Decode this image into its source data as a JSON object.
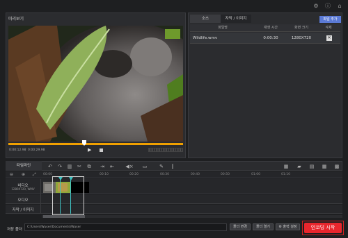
{
  "top_icons": [
    "gear-icon",
    "info-icon",
    "home-icon"
  ],
  "preview": {
    "title": "미리보기",
    "current_time": "0:00:12.98",
    "total_time": "0:00:29.98",
    "progress": 0.41
  },
  "source_panel": {
    "tabs": [
      "소스",
      "자막 / 이미지"
    ],
    "add_file_label": "파일 추가",
    "columns": [
      "파일명",
      "재생 시간",
      "화면 크기",
      "삭제"
    ],
    "rows": [
      {
        "name": "Wildlife.wmv",
        "duration": "0:00:30",
        "size": "1280X720"
      }
    ]
  },
  "timeline": {
    "label": "타임라인",
    "ticks": [
      "00:00",
      "00:10",
      "00:20",
      "00:30",
      "00:40",
      "00:50",
      "01:00",
      "01:10"
    ],
    "tracks": {
      "video_label": "비디오",
      "video_sub": "1280X720, WMV",
      "audio_label": "오디오",
      "subtitle_label": "자막 / 이미지"
    }
  },
  "footer": {
    "save_folder_label": "저장 폴더",
    "save_path": "C:\\Users\\Wuser\\Documents\\Wuser",
    "change_folder": "폴더 변경",
    "open_folder": "폴더 열기",
    "output_settings": "출력 설정",
    "encode_start": "인코딩 시작"
  },
  "colors": {
    "accent_orange": "#f0a000",
    "encode_red": "#e8262d",
    "add_file_blue": "#5b7ad6"
  }
}
